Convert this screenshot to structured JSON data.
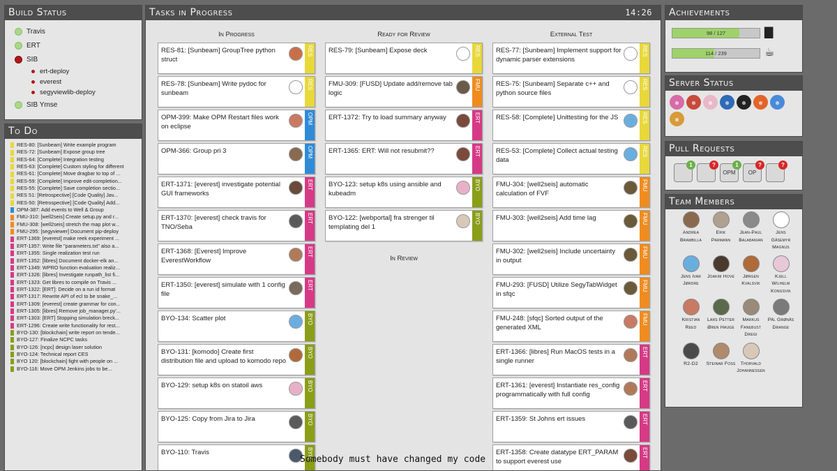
{
  "build_status": {
    "title": "Build Status",
    "items": [
      {
        "label": "Travis",
        "status": "green"
      },
      {
        "label": "ERT",
        "status": "green"
      },
      {
        "label": "SIB",
        "status": "red"
      },
      {
        "label": "ert-deploy",
        "status": "red",
        "sub": true
      },
      {
        "label": "everest",
        "status": "red",
        "sub": true
      },
      {
        "label": "segyviewlib-deploy",
        "status": "red",
        "sub": true
      },
      {
        "label": "SIB Ymse",
        "status": "green"
      }
    ]
  },
  "todo": {
    "title": "To Do",
    "items": [
      {
        "text": "RES-80: [Sunbeam] Write example program",
        "color": "#e8d83a"
      },
      {
        "text": "RES-72: [Sunbeam] Expose group tree",
        "color": "#e8d83a"
      },
      {
        "text": "RES-64: [Complete] Integration testing",
        "color": "#e8d83a"
      },
      {
        "text": "RES-63: [Complete] Custom styling for different",
        "color": "#e8d83a"
      },
      {
        "text": "RES-61: [Complete] Move dragbar to top of ...",
        "color": "#e8d83a"
      },
      {
        "text": "RES-59: [Complete] Improve edit-completion...",
        "color": "#e8d83a"
      },
      {
        "text": "RES-55: [Complete] Save completion sectio...",
        "color": "#e8d83a"
      },
      {
        "text": "RES 51: [Retrospective] [Code Quality] Jav...",
        "color": "#e8d83a"
      },
      {
        "text": "RES-50: [Retrospective] [Code Quality] Add...",
        "color": "#e8d83a"
      },
      {
        "text": "OPM-387: Add events to Well & Group",
        "color": "#2f8bd8"
      },
      {
        "text": "FMU-310: [well2seis] Create setup.py and r...",
        "color": "#f08c1e"
      },
      {
        "text": "FMU-308: [well2seis] stretch the map plot w...",
        "color": "#f08c1e"
      },
      {
        "text": "FMU-295: [segyviewer] Document pip-deploy",
        "color": "#f08c1e"
      },
      {
        "text": "ERT-1369: [everest] make reek experiment ...",
        "color": "#d63a86"
      },
      {
        "text": "ERT-1357: Write file \"parameters.txt\" also a...",
        "color": "#d63a86"
      },
      {
        "text": "ERT-1355: Single realization test run",
        "color": "#d63a86"
      },
      {
        "text": "ERT-1352: [libres] Document docker-elk an...",
        "color": "#d63a86"
      },
      {
        "text": "ERT-1349: WPRO function evaluation realiz...",
        "color": "#d63a86"
      },
      {
        "text": "ERT-1326: [libres] Investigate runpath_list fi...",
        "color": "#d63a86"
      },
      {
        "text": "ERT-1323: Get libres to compile on Travis ...",
        "color": "#d63a86"
      },
      {
        "text": "ERT-1322: [ERT]: Decide on a run id format",
        "color": "#d63a86"
      },
      {
        "text": "ERT-1317: Rewrite API of ecl to be snake_...",
        "color": "#d63a86"
      },
      {
        "text": "ERT-1309: [everest] create grammar for con...",
        "color": "#d63a86"
      },
      {
        "text": "ERT-1305: [libres] Remove job_manager.py'...",
        "color": "#d63a86"
      },
      {
        "text": "ERT-1303: [ERT] Stopping simulation breck...",
        "color": "#d63a86"
      },
      {
        "text": "ERT-1296: Create write functionality for rest...",
        "color": "#d63a86"
      },
      {
        "text": "BYO-130: [blockchain] write report on tende...",
        "color": "#8a9e18"
      },
      {
        "text": "BYO-127: Finalize NCPC tasks",
        "color": "#8a9e18"
      },
      {
        "text": "BYO-126: [ncpc] design laser solution",
        "color": "#8a9e18"
      },
      {
        "text": "BYO-124: Technical report CES",
        "color": "#8a9e18"
      },
      {
        "text": "BYO 120: [blockchain] fight with people on ...",
        "color": "#8a9e18"
      },
      {
        "text": "BYO-116: Move OPM Jenkins jobs to be...",
        "color": "#8a9e18"
      }
    ]
  },
  "tasks": {
    "title": "Tasks in Progress",
    "clock": "14:26",
    "columns": [
      {
        "title": "In Progress",
        "cards": [
          {
            "text": "RES-81: [Sunbeam] GroupTree python struct",
            "tag": "RES",
            "color": "#e8d83a",
            "avatar": "#c9704a"
          },
          {
            "text": "RES-78: [Sunbeam] Write pydoc for sunbeam",
            "tag": "RES",
            "color": "#e8d83a",
            "avatar": "#ffffff"
          },
          {
            "text": "OPM-399: Make OPM Restart files work on eclipse",
            "tag": "OPM",
            "color": "#2f8bd8",
            "avatar": "#c87a64"
          },
          {
            "text": "OPM-366: Group pri 3",
            "tag": "OPM",
            "color": "#2f8bd8",
            "avatar": "#8a6a4e"
          },
          {
            "text": "ERT-1371: [everest] investigate potential GUI frameworks",
            "tag": "ERT",
            "color": "#d63a86",
            "avatar": "#6a4a3a"
          },
          {
            "text": "ERT-1370: [everest] check travis for TNO/Seba",
            "tag": "ERT",
            "color": "#d63a86",
            "avatar": "#5a5a5a"
          },
          {
            "text": "ERT-1368: [Everest] Improve EverestWorkflow",
            "tag": "ERT",
            "color": "#d63a86",
            "avatar": "#b07a5a"
          },
          {
            "text": "ERT-1350: [everest] simulate with 1 config file",
            "tag": "ERT",
            "color": "#d63a86",
            "avatar": "#7a6a5a"
          },
          {
            "text": "BYO-134: Scatter plot",
            "tag": "BYO",
            "color": "#8a9e18",
            "avatar": "#6aaee0"
          },
          {
            "text": "BYO-131: [komodo] Create first distribution file and upload to komodo repo",
            "tag": "BYO",
            "color": "#8a9e18",
            "avatar": "#b06a3a"
          },
          {
            "text": "BYO-129: setup k8s on statoil aws",
            "tag": "BYO",
            "color": "#8a9e18",
            "avatar": "#e8b0c8"
          },
          {
            "text": "BYO-125: Copy from Jira to Jira",
            "tag": "BYO",
            "color": "#8a9e18",
            "avatar": "#5a5a5a"
          },
          {
            "text": "BYO-110: Travis",
            "tag": "BYO",
            "color": "#8a9e18",
            "avatar": "#4a5a6a"
          }
        ]
      },
      {
        "title": "Ready for Review",
        "cards": [
          {
            "text": "RES-79: [Sunbeam] Expose deck",
            "tag": "RES",
            "color": "#e8d83a",
            "avatar": "#ffffff"
          },
          {
            "text": "FMU-309: [FUSD] Update add/remove tab logic",
            "tag": "FMU",
            "color": "#f08c1e",
            "avatar": "#6a5a4a"
          },
          {
            "text": "ERT-1372: Try to load summary anyway",
            "tag": "ERT",
            "color": "#d63a86",
            "avatar": "#7a4a3a"
          },
          {
            "text": "ERT-1365: ERT: Will not resubmit??",
            "tag": "ERT",
            "color": "#d63a86",
            "avatar": "#7a4a3a"
          },
          {
            "text": "BYO-123: setup k8s using ansible and kubeadm",
            "tag": "BYO",
            "color": "#8a9e18",
            "avatar": "#e8b0c8"
          },
          {
            "text": "BYO-122: [webportal] fra strenger til templating del 1",
            "tag": "BYO",
            "color": "#8a9e18",
            "avatar": "#d8c8b8"
          }
        ],
        "sub_title": "In Review"
      },
      {
        "title": "External Test",
        "cards": [
          {
            "text": "RES-77: [Sunbeam] Implement support for dynamic parser extensions",
            "tag": "RES",
            "color": "#e8d83a",
            "avatar": "#ffffff"
          },
          {
            "text": "RES-75: [Sunbeam] Separate c++ and python source files",
            "tag": "RES",
            "color": "#e8d83a",
            "avatar": "#ffffff"
          },
          {
            "text": "RES-58: [Complete] Unittesting for the JS",
            "tag": "RES",
            "color": "#e8d83a",
            "avatar": "#6aaee0"
          },
          {
            "text": "RES-53: [Complete] Collect actual testing data",
            "tag": "RES",
            "color": "#e8d83a",
            "avatar": "#6aaee0"
          },
          {
            "text": "FMU-304: [well2seis] automatic calculation of FVF",
            "tag": "FMU",
            "color": "#f08c1e",
            "avatar": "#6a5a3a"
          },
          {
            "text": "FMU-303: [well2seis] Add time lag",
            "tag": "FMU",
            "color": "#f08c1e",
            "avatar": "#6a5a3a"
          },
          {
            "text": "FMU-302: [well2seis] Include uncertainty in output",
            "tag": "FMU",
            "color": "#f08c1e",
            "avatar": "#6a5a3a"
          },
          {
            "text": "FMU-293: [FUSD] Utilize SegyTabWidget in sfqc",
            "tag": "FMU",
            "color": "#f08c1e",
            "avatar": "#6a5a3a"
          },
          {
            "text": "FMU-248: [sfqc] Sorted output of the generated XML",
            "tag": "FMU",
            "color": "#f08c1e",
            "avatar": "#c87a64"
          },
          {
            "text": "ERT-1366: [libres] Run MacOS tests in a single runner",
            "tag": "ERT",
            "color": "#d63a86",
            "avatar": "#b07a5a"
          },
          {
            "text": "ERT-1361: [everest] Instantiate res_config programmatically with full config",
            "tag": "ERT",
            "color": "#d63a86",
            "avatar": "#b07a5a"
          },
          {
            "text": "ERT-1359: St Johns ert issues",
            "tag": "ERT",
            "color": "#d63a86",
            "avatar": "#5a5a5a"
          },
          {
            "text": "ERT-1358: Create datatype ERT_PARAM to support everest use",
            "tag": "ERT",
            "color": "#d63a86",
            "avatar": "#7a4a3a"
          }
        ]
      }
    ]
  },
  "achievements": {
    "title": "Achievements",
    "items": [
      {
        "label": "98 / 127",
        "value": 98,
        "max": 127,
        "icon": "cake-icon"
      },
      {
        "label": "114 / 239",
        "value": 114,
        "max": 239,
        "icon": "beer-pizza-icon"
      }
    ]
  },
  "server_status": {
    "title": "Server Status",
    "icons": [
      {
        "name": "flower-server-icon",
        "color": "#d86aa8"
      },
      {
        "name": "jenkins-icon",
        "color": "#c84a3a"
      },
      {
        "name": "egg-icon",
        "color": "#e8b8c8"
      },
      {
        "name": "openstack-icon",
        "color": "#2f6bb8"
      },
      {
        "name": "github-icon",
        "color": "#222222"
      },
      {
        "name": "gitlab-icon",
        "color": "#e2642a"
      },
      {
        "name": "cloud-icon",
        "color": "#4a8ad8"
      },
      {
        "name": "pizza-server-icon",
        "color": "#d89a3a"
      }
    ]
  },
  "pull_requests": {
    "title": "Pull Requests",
    "items": [
      {
        "name": "pr-avatar-1",
        "label": "",
        "badge": "1",
        "badge_color": "#6ab04a"
      },
      {
        "name": "pr-avatar-2",
        "label": "",
        "badge": "?",
        "badge_color": "#d62828"
      },
      {
        "name": "pr-opm",
        "label": "OPM",
        "badge": "1",
        "badge_color": "#6ab04a"
      },
      {
        "name": "pr-opm-2",
        "label": "OP",
        "badge": "?",
        "badge_color": "#d62828"
      },
      {
        "name": "pr-flower",
        "label": "",
        "badge": "?",
        "badge_color": "#d62828"
      }
    ]
  },
  "team": {
    "title": "Team Members",
    "members": [
      {
        "name": "Andrea Brambilla",
        "color": "#8a6a4e"
      },
      {
        "name": "Erik Parmann",
        "color": "#b0a090"
      },
      {
        "name": "Jean-Paul Balabanian",
        "color": "#8a8a8a"
      },
      {
        "name": "Jens Gåsemyr Magnus",
        "color": "#ffffff"
      },
      {
        "name": "Jens Ivar Jørdre",
        "color": "#6aaee0"
      },
      {
        "name": "Joakim Hove",
        "color": "#4a3a2e"
      },
      {
        "name": "Jørgen Kvalsvik",
        "color": "#b06a3a"
      },
      {
        "name": "Kjell Wilhelm Kongsvik",
        "color": "#e8c8d8"
      },
      {
        "name": "Kristian Reed",
        "color": "#c87a64"
      },
      {
        "name": "Lars Petter Øren Hauge",
        "color": "#5a6a4a"
      },
      {
        "name": "Markus Fanebust Dregi",
        "color": "#9a8a7a"
      },
      {
        "name": "Pål Grønås Drange",
        "color": "#7a7a7a"
      },
      {
        "name": "R2-D2",
        "color": "#4a4a4a"
      },
      {
        "name": "Steinar Foss",
        "color": "#b08a6a"
      },
      {
        "name": "Thorvald Johannessen",
        "color": "#d8c8b8"
      }
    ]
  },
  "subtitle": "Somebody must have changed my code"
}
